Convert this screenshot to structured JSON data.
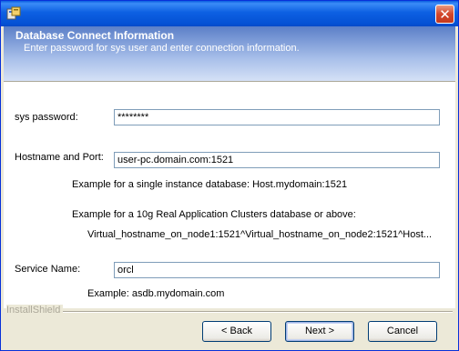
{
  "window": {
    "close_glyph": "✕"
  },
  "header": {
    "title": "Database Connect Information",
    "subtitle": "Enter password for sys user and enter connection information."
  },
  "form": {
    "sys_password_label": "sys password:",
    "sys_password_value": "********",
    "hostname_label": "Hostname and Port:",
    "hostname_value": "user-pc.domain.com:1521",
    "example_single": "Example for a single instance database: Host.mydomain:1521",
    "example_rac": "Example for a 10g Real Application Clusters database or above:",
    "example_rac_value": "Virtual_hostname_on_node1:1521^Virtual_hostname_on_node2:1521^Host...",
    "service_label": "Service Name:",
    "service_value": "orcl",
    "service_example": "Example: asdb.mydomain.com"
  },
  "footer": {
    "brand": "InstallShield",
    "back_label": "< Back",
    "next_label": "Next >",
    "cancel_label": "Cancel"
  },
  "colors": {
    "titlebar": "#0451d4",
    "banner": "#5b7fc8",
    "dialog": "#ece9d8"
  }
}
